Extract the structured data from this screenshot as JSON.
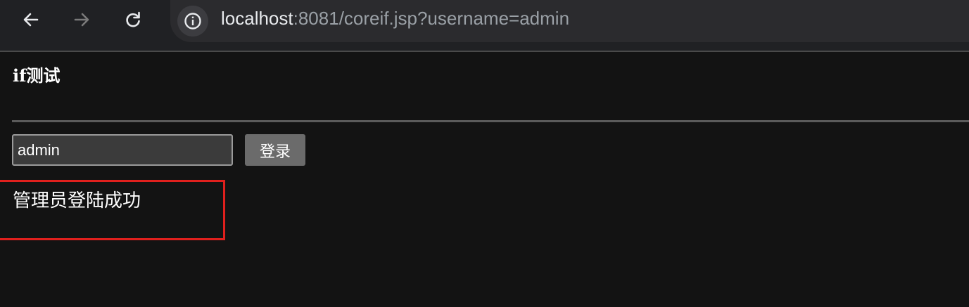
{
  "browser": {
    "url_host": "localhost",
    "url_rest": ":8081/coreif.jsp?username=admin",
    "icons": {
      "back": "arrow-left-icon",
      "forward": "arrow-right-icon",
      "reload": "reload-icon",
      "site_info": "info-icon"
    }
  },
  "page": {
    "heading": "if测试",
    "username_value": "admin",
    "login_label": "登录",
    "result_message": "管理员登陆成功",
    "highlight_color": "#e0201d"
  }
}
